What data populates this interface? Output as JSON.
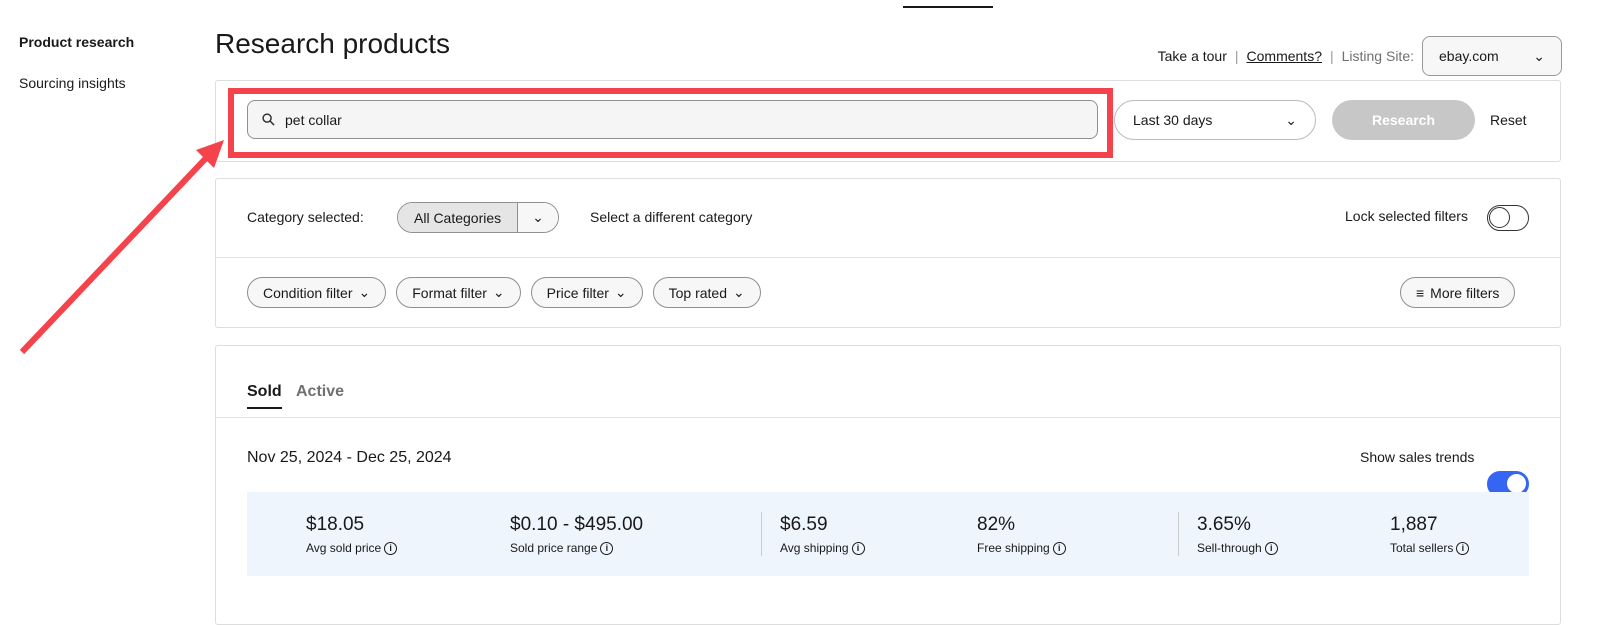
{
  "sidebar": {
    "items": [
      {
        "label": "Product research",
        "active": true
      },
      {
        "label": "Sourcing insights",
        "active": false
      }
    ]
  },
  "header": {
    "title": "Research products",
    "take_tour": "Take a tour",
    "comments": "Comments?",
    "listing_site_label": "Listing Site:",
    "listing_site_value": "ebay.com",
    "divider": "|"
  },
  "search": {
    "value": "pet collar",
    "icon": "search-icon",
    "period": "Last 30 days",
    "research_label": "Research",
    "reset_label": "Reset"
  },
  "filters": {
    "category_label": "Category selected:",
    "category_value": "All Categories",
    "different_category": "Select a different category",
    "lock_label": "Lock selected filters",
    "lock_on": false,
    "chips": [
      "Condition filter",
      "Format filter",
      "Price filter",
      "Top rated"
    ],
    "more_filters": "More filters"
  },
  "results": {
    "tabs": [
      {
        "label": "Sold",
        "active": true
      },
      {
        "label": "Active",
        "active": false
      }
    ],
    "date_range": "Nov 25, 2024 - Dec 25, 2024",
    "trends_label": "Show sales trends",
    "trends_on": true,
    "stats": [
      {
        "value": "$18.05",
        "label": "Avg sold price"
      },
      {
        "value": "$0.10 - $495.00",
        "label": "Sold price range"
      },
      {
        "value": "$6.59",
        "label": "Avg shipping"
      },
      {
        "value": "82%",
        "label": "Free shipping"
      },
      {
        "value": "3.65%",
        "label": "Sell-through"
      },
      {
        "value": "1,887",
        "label": "Total sellers"
      }
    ]
  },
  "colors": {
    "highlight": "#f5434b",
    "toggle_on": "#3665f3",
    "stats_bg": "#eef5fd"
  }
}
